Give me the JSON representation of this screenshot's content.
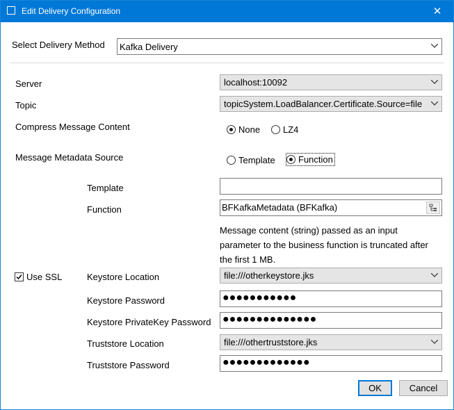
{
  "window": {
    "title": "Edit Delivery Configuration",
    "close_glyph": "✕"
  },
  "delivery": {
    "label": "Select Delivery Method",
    "value": "Kafka Delivery"
  },
  "server": {
    "label": "Server",
    "value": "localhost:10092"
  },
  "topic": {
    "label": "Topic",
    "value": "topicSystem.LoadBalancer.Certificate.Source=file"
  },
  "compress": {
    "label": "Compress Message Content",
    "options": [
      "None",
      "LZ4"
    ],
    "selected": "None"
  },
  "metadata": {
    "label": "Message Metadata Source",
    "options": [
      "Template",
      "Function"
    ],
    "selected": "Function"
  },
  "template": {
    "label": "Template",
    "value": ""
  },
  "function": {
    "label": "Function",
    "value": "BFKafkaMetadata (BFKafka)"
  },
  "note": "Message content (string) passed as an input parameter to the business function is truncated after the first 1 MB.",
  "ssl": {
    "label": "Use SSL",
    "checked": true
  },
  "keystore_location": {
    "label": "Keystore Location",
    "value": "file:///otherkeystore.jks"
  },
  "keystore_password": {
    "label": "Keystore Password",
    "value": "●●●●●●●●●●●"
  },
  "keystore_privatekey_password": {
    "label": "Keystore PrivateKey Password",
    "value": "●●●●●●●●●●●●●●"
  },
  "truststore_location": {
    "label": "Truststore Location",
    "value": "file:///othertruststore.jks"
  },
  "truststore_password": {
    "label": "Truststore Password",
    "value": "●●●●●●●●●●●●●"
  },
  "buttons": {
    "ok": "OK",
    "cancel": "Cancel"
  },
  "colors": {
    "titlebar": "#0078d7",
    "accent": "#0078d7"
  }
}
